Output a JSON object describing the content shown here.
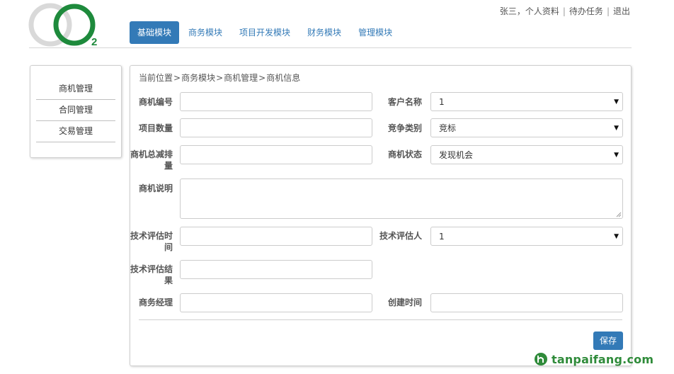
{
  "logo": {
    "subscript": "2"
  },
  "user_menu": [
    "张三，个人资料",
    "待办任务",
    "退出"
  ],
  "user_menu_separator": "|",
  "nav": [
    "基础模块",
    "商务模块",
    "项目开发模块",
    "财务模块",
    "管理模块"
  ],
  "nav_active": "基础模块",
  "sidebar": [
    "商机管理",
    "合同管理",
    "交易管理"
  ],
  "breadcrumb": [
    "当前位置",
    "商务模块",
    "商机管理",
    "商机信息"
  ],
  "breadcrumb_separator": ">",
  "form": {
    "opportunity_no": {
      "label": "商机编号",
      "value": ""
    },
    "customer_name": {
      "label": "客户名称",
      "value": "1"
    },
    "project_count": {
      "label": "项目数量",
      "value": ""
    },
    "competition_type": {
      "label": "竞争类别",
      "value": "竞标"
    },
    "total_rank": {
      "label": "商机总减排量",
      "value": ""
    },
    "opportunity_status": {
      "label": "商机状态",
      "value": "发现机会"
    },
    "description": {
      "label": "商机说明",
      "value": ""
    },
    "tech_eval_time": {
      "label": "技术评估时间",
      "value": ""
    },
    "tech_evaluator": {
      "label": "技术评估人",
      "value": "1"
    },
    "tech_eval_result": {
      "label": "技术评估结果",
      "value": ""
    },
    "business_manager": {
      "label": "商务经理",
      "value": ""
    },
    "create_time": {
      "label": "创建时间",
      "value": ""
    }
  },
  "save_label": "保存",
  "watermark": "tanpaifang.com",
  "colors": {
    "primary": "#337ab7",
    "logo_green": "#1e8a3c",
    "logo_grey": "#d9d9d9"
  }
}
